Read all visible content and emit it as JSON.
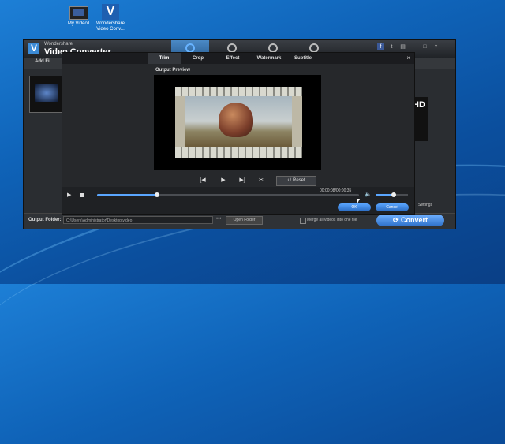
{
  "desktop": {
    "icons": [
      {
        "label_line1": "My Video1",
        "label_line2": ""
      },
      {
        "label_line1": "Wondershare",
        "label_line2": "Video Conv..."
      }
    ]
  },
  "app": {
    "brand": "Wondershare",
    "product": "Video Converter",
    "add_files": "Add Fil",
    "badge_text": "HD",
    "settings": "Settings"
  },
  "dialog": {
    "tabs": [
      "Trim",
      "Crop",
      "Effect",
      "Watermark",
      "Subtitle"
    ],
    "active_tab": "Trim",
    "close": "×",
    "output_preview": "Output Preview",
    "reset": "Reset",
    "time": "00:00:08/00:00:35",
    "progress": 0.23,
    "volume": 0.55,
    "ok": "OK",
    "cancel": "Cancel"
  },
  "bottom": {
    "output_folder_label": "Output Folder:",
    "output_path": "C:\\Users\\Administrator\\Desktop\\video",
    "dots": "•••",
    "open_folder": "Open Folder",
    "merge_label": "Merge all videos into one file",
    "convert": "Convert"
  }
}
